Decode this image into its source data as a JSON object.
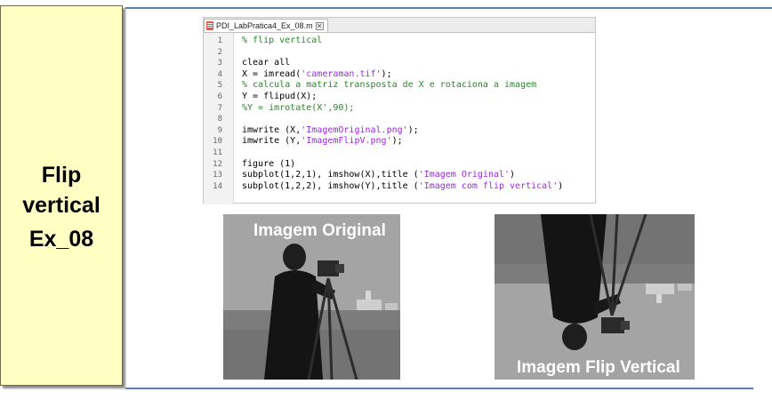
{
  "side_panel": {
    "title_line1": "Flip",
    "title_line2": "vertical",
    "code": "Ex_08"
  },
  "editor": {
    "tab_label": "PDI_LabPratica4_Ex_08.m",
    "close_glyph": "✕",
    "lines": [
      {
        "num": "1",
        "segments": [
          {
            "t": "% flip vertical",
            "c": "comment"
          }
        ]
      },
      {
        "num": "2",
        "segments": []
      },
      {
        "num": "3",
        "segments": [
          {
            "t": "clear all",
            "c": "plain"
          }
        ]
      },
      {
        "num": "4",
        "segments": [
          {
            "t": "X = imread(",
            "c": "plain"
          },
          {
            "t": "'cameraman.tif'",
            "c": "string"
          },
          {
            "t": ");",
            "c": "plain"
          }
        ]
      },
      {
        "num": "5",
        "segments": [
          {
            "t": "% calcula a matriz transposta de X e rotaciona a imagem",
            "c": "comment"
          }
        ]
      },
      {
        "num": "6",
        "segments": [
          {
            "t": "Y = flipud(X);",
            "c": "plain"
          }
        ]
      },
      {
        "num": "7",
        "segments": [
          {
            "t": "%Y = imrotate(X',90);",
            "c": "comment"
          }
        ]
      },
      {
        "num": "8",
        "segments": []
      },
      {
        "num": "9",
        "segments": [
          {
            "t": "imwrite (X,",
            "c": "plain"
          },
          {
            "t": "'ImagemOriginal.png'",
            "c": "string"
          },
          {
            "t": ");",
            "c": "plain"
          }
        ]
      },
      {
        "num": "10",
        "segments": [
          {
            "t": "imwrite (Y,",
            "c": "plain"
          },
          {
            "t": "'ImagemFlipV.png'",
            "c": "string"
          },
          {
            "t": ");",
            "c": "plain"
          }
        ]
      },
      {
        "num": "11",
        "segments": []
      },
      {
        "num": "12",
        "segments": [
          {
            "t": "figure (1)",
            "c": "plain"
          }
        ]
      },
      {
        "num": "13",
        "segments": [
          {
            "t": "subplot(1,2,1), imshow(X),title (",
            "c": "plain"
          },
          {
            "t": "'Imagem Original'",
            "c": "string"
          },
          {
            "t": ")",
            "c": "plain"
          }
        ]
      },
      {
        "num": "14",
        "segments": [
          {
            "t": "subplot(1,2,2), imshow(Y),title (",
            "c": "plain"
          },
          {
            "t": "'Imagem com flip vertical'",
            "c": "string"
          },
          {
            "t": ")",
            "c": "plain"
          }
        ]
      }
    ]
  },
  "images": {
    "original_title": "Imagem Original",
    "flip_title": "Imagem Flip Vertical"
  },
  "colors": {
    "panel_bg": "#ffffc4",
    "rule": "#5b7fb4",
    "comment": "#228b22",
    "string": "#a020f0"
  }
}
